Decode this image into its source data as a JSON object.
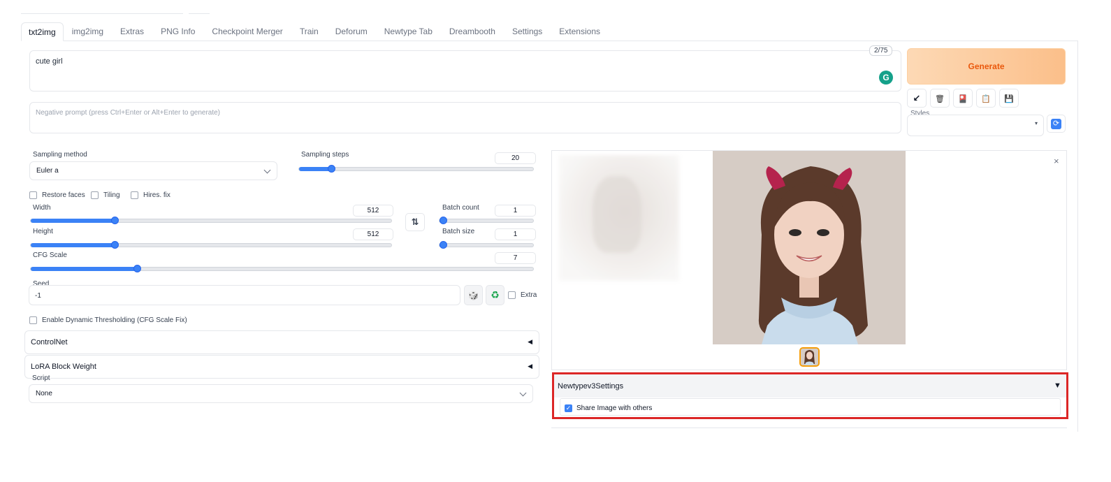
{
  "tabs": [
    "txt2img",
    "img2img",
    "Extras",
    "PNG Info",
    "Checkpoint Merger",
    "Train",
    "Deforum",
    "Newtype Tab",
    "Dreambooth",
    "Settings",
    "Extensions"
  ],
  "prompt": {
    "value": "cute girl",
    "token_count": "2/75",
    "grammarly_icon": "G"
  },
  "negative_prompt": {
    "placeholder": "Negative prompt (press Ctrl+Enter or Alt+Enter to generate)"
  },
  "generate": {
    "label": "Generate",
    "accent": "#ea580c"
  },
  "toolbar": {
    "icons": [
      "arrow-down-left-icon",
      "trash-icon",
      "red-card-icon",
      "clipboard-icon",
      "save-icon"
    ],
    "glyphs": [
      "↙",
      "🗑",
      "🎴",
      "📋",
      "💾"
    ]
  },
  "styles": {
    "label": "Styles",
    "value": "",
    "caret": "▾",
    "refresh_glyph": "⟳"
  },
  "sampling": {
    "method_label": "Sampling method",
    "method_value": "Euler a",
    "steps_label": "Sampling steps",
    "steps_value": "20"
  },
  "options": {
    "restore_faces": "Restore faces",
    "tiling": "Tiling",
    "hires_fix": "Hires. fix"
  },
  "size": {
    "width_label": "Width",
    "width_value": "512",
    "height_label": "Height",
    "height_value": "512",
    "swap_glyph": "⇅"
  },
  "batch": {
    "count_label": "Batch count",
    "count_value": "1",
    "size_label": "Batch size",
    "size_value": "1"
  },
  "cfg": {
    "label": "CFG Scale",
    "value": "7"
  },
  "seed": {
    "label": "Seed",
    "value": "-1",
    "dice_glyph": "🎲",
    "recycle_glyph": "♻",
    "extra_label": "Extra"
  },
  "dynamic_thresholding": {
    "label": "Enable Dynamic Thresholding (CFG Scale Fix)"
  },
  "accordions": {
    "controlnet": "ControlNet",
    "lora": "LoRA Block Weight",
    "arrow": "◀"
  },
  "script": {
    "label": "Script",
    "value": "None"
  },
  "gallery": {
    "close_glyph": "×"
  },
  "newtype_settings": {
    "title": "Newtypev3Settings",
    "arrow": "▼",
    "share_label": "Share Image with others",
    "share_checked": true,
    "check_glyph": "✓"
  },
  "colors": {
    "accent": "#3b82f6",
    "highlight": "#dc2626"
  }
}
